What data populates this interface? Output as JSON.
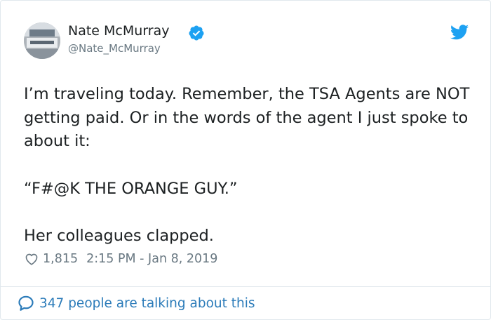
{
  "author": {
    "name": "Nate McMurray",
    "handle": "@Nate_McMurray",
    "verified": true,
    "avatar_icon": "avatar-photo"
  },
  "tweet": {
    "paragraphs": [
      "I’m traveling today. Remember, the TSA Agents are NOT getting paid. Or in the words of the agent I just spoke to about it:",
      "“F#@K THE ORANGE GUY.”",
      "Her colleagues clapped."
    ],
    "likes": "1,815",
    "timestamp": "2:15 PM - Jan 8, 2019"
  },
  "footer": {
    "talking_text": "347 people are talking about this"
  },
  "icons": {
    "verified": "verified-badge-icon",
    "twitter": "twitter-bird-icon",
    "like": "heart-icon",
    "reply": "speech-bubble-icon"
  },
  "colors": {
    "twitter_blue": "#1da1f2",
    "link_blue": "#2b7bb9",
    "secondary_text": "#697882",
    "border": "#e1e8ed"
  }
}
